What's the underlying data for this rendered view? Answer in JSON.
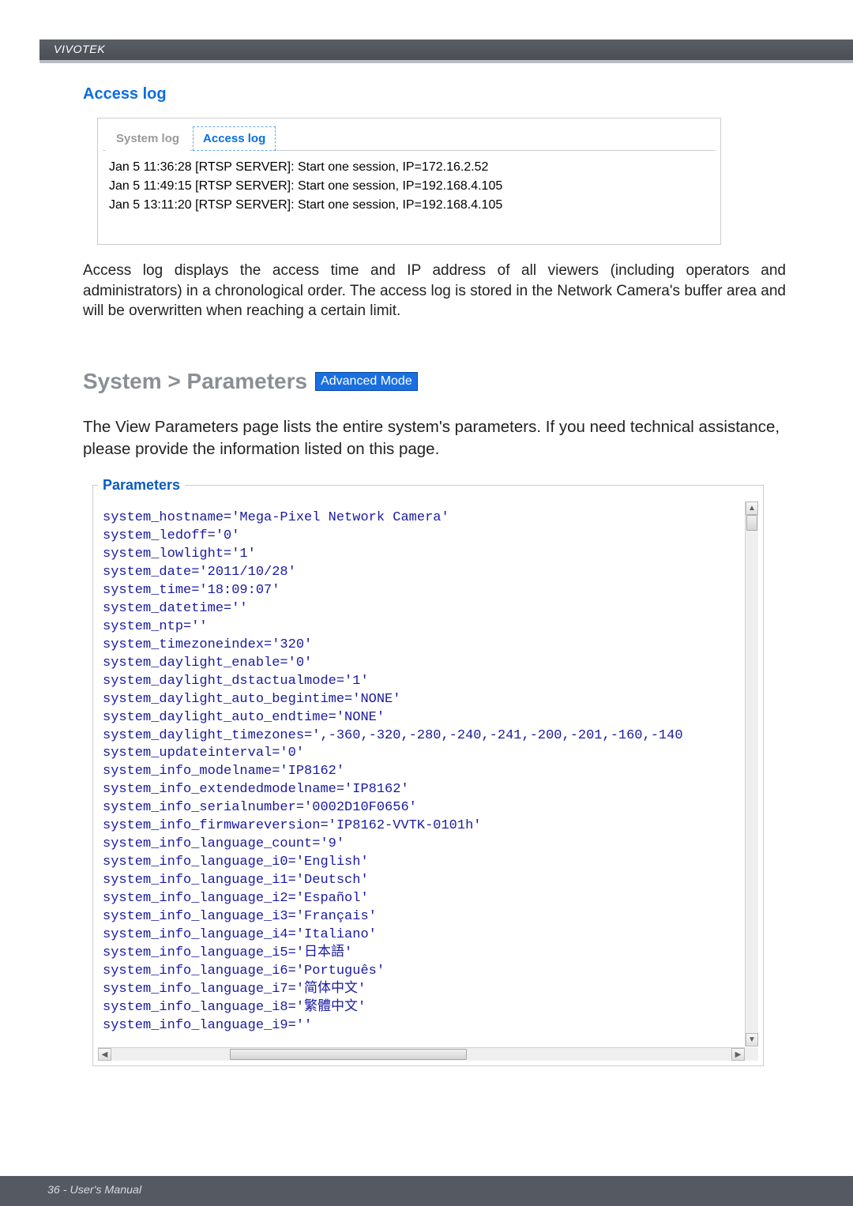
{
  "brand": "VIVOTEK",
  "access_log": {
    "title": "Access log",
    "tabs": [
      {
        "label": "System log",
        "active": false
      },
      {
        "label": "Access log",
        "active": true
      }
    ],
    "entries": [
      "Jan 5 11:36:28 [RTSP SERVER]: Start one session, IP=172.16.2.52",
      "Jan 5 11:49:15 [RTSP SERVER]: Start one session, IP=192.168.4.105",
      "Jan 5 13:11:20 [RTSP SERVER]: Start one session, IP=192.168.4.105"
    ],
    "description": "Access log displays the access time and IP address of all viewers (including operators and administrators) in a chronological order. The access log is stored in the Network Camera's buffer area and will be overwritten when reaching a certain limit."
  },
  "parameters_section": {
    "heading": "System > Parameters",
    "badge": "Advanced Mode",
    "intro": "The View Parameters page lists the entire system's parameters. If you need technical assistance, please provide the information listed on this page.",
    "legend": "Parameters",
    "lines": [
      "system_hostname='Mega-Pixel Network Camera'",
      "system_ledoff='0'",
      "system_lowlight='1'",
      "system_date='2011/10/28'",
      "system_time='18:09:07'",
      "system_datetime=''",
      "system_ntp=''",
      "system_timezoneindex='320'",
      "system_daylight_enable='0'",
      "system_daylight_dstactualmode='1'",
      "system_daylight_auto_begintime='NONE'",
      "system_daylight_auto_endtime='NONE'",
      "system_daylight_timezones=',-360,-320,-280,-240,-241,-200,-201,-160,-140",
      "system_updateinterval='0'",
      "system_info_modelname='IP8162'",
      "system_info_extendedmodelname='IP8162'",
      "system_info_serialnumber='0002D10F0656'",
      "system_info_firmwareversion='IP8162-VVTK-0101h'",
      "system_info_language_count='9'",
      "system_info_language_i0='English'",
      "system_info_language_i1='Deutsch'",
      "system_info_language_i2='Español'",
      "system_info_language_i3='Français'",
      "system_info_language_i4='Italiano'",
      "system_info_language_i5='日本語'",
      "system_info_language_i6='Português'",
      "system_info_language_i7='简体中文'",
      "system_info_language_i8='繁體中文'",
      "system_info_language_i9=''"
    ]
  },
  "footer": "36 - User's Manual"
}
